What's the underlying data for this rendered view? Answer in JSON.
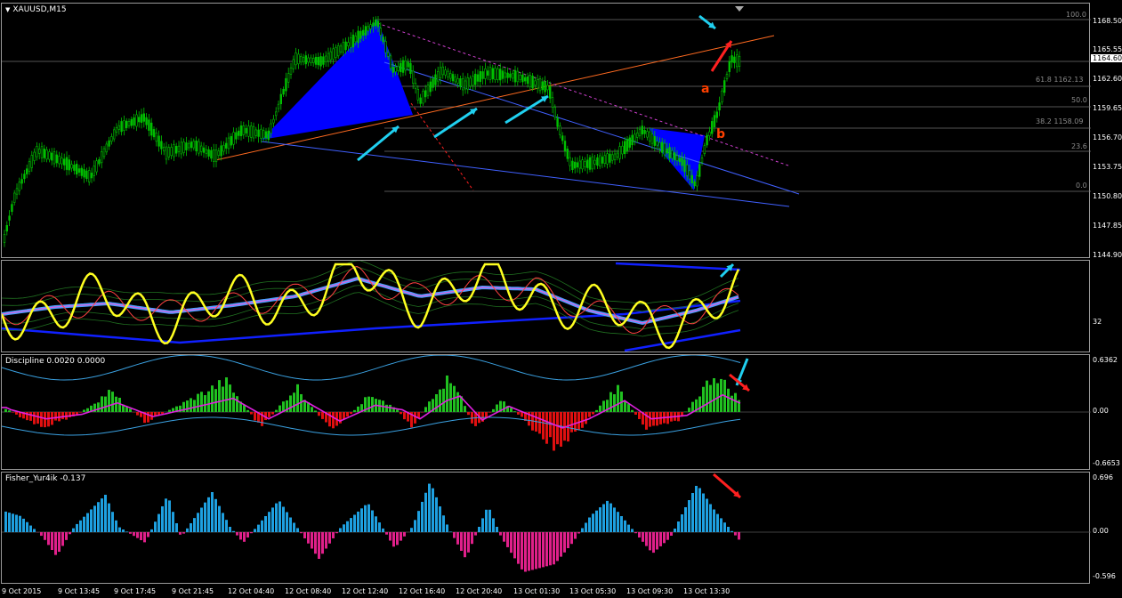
{
  "main_chart": {
    "title": "XAUUSD,M15",
    "current_price": "1164.60",
    "price_scale": [
      "1168.50",
      "1165.55",
      "1162.60",
      "1159.65",
      "1156.70",
      "1153.75",
      "1150.80",
      "1147.85",
      "1144.90"
    ],
    "fib_levels": [
      {
        "label": "100.0"
      },
      {
        "label": "61.8 1162.13"
      },
      {
        "label": "50.0"
      },
      {
        "label": "38.2 1158.09"
      },
      {
        "label": "23.6"
      },
      {
        "label": "0.0"
      }
    ],
    "wave_labels": [
      "a",
      "b"
    ]
  },
  "indicator1": {
    "scale_label": "32"
  },
  "discipline": {
    "title": "Discipline 0.0020 0.0000",
    "scale": [
      "0.6362",
      "0.00",
      "-0.6653"
    ]
  },
  "fisher": {
    "title": "Fisher_Yur4ik -0.137",
    "scale": [
      "0.696",
      "0.00",
      "-0.596"
    ]
  },
  "time_axis": [
    "9 Oct 2015",
    "9 Oct 13:45",
    "9 Oct 17:45",
    "9 Oct 21:45",
    "12 Oct 04:40",
    "12 Oct 08:40",
    "12 Oct 12:40",
    "12 Oct 16:40",
    "12 Oct 20:40",
    "13 Oct 01:30",
    "13 Oct 05:30",
    "13 Oct 09:30",
    "13 Oct 13:30"
  ],
  "colors": {
    "bull_candle": "#00c000",
    "wedge": "#0000ff",
    "fisher_pos": "#1ea0e0",
    "fisher_neg": "#e0208a",
    "discipline_pos": "#20c020",
    "discipline_neg": "#e01010",
    "arrow_cyan": "#20d0f0",
    "arrow_red": "#ff2020"
  }
}
